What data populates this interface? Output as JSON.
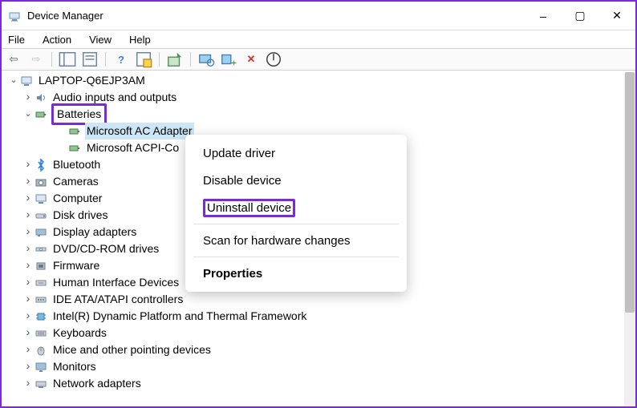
{
  "window": {
    "title": "Device Manager"
  },
  "menu": {
    "file": "File",
    "action": "Action",
    "view": "View",
    "help": "Help"
  },
  "root": "LAPTOP-Q6EJP3AM",
  "batteries": {
    "label": "Batteries",
    "children": {
      "ac": "Microsoft AC Adapter",
      "acpi": "Microsoft ACPI-Co"
    }
  },
  "cats": {
    "audio": "Audio inputs and outputs",
    "bluetooth": "Bluetooth",
    "cameras": "Cameras",
    "computer": "Computer",
    "disk": "Disk drives",
    "display": "Display adapters",
    "dvd": "DVD/CD-ROM drives",
    "firmware": "Firmware",
    "hid": "Human Interface Devices",
    "ide": "IDE ATA/ATAPI controllers",
    "intel": "Intel(R) Dynamic Platform and Thermal Framework",
    "keyboards": "Keyboards",
    "mice": "Mice and other pointing devices",
    "monitors": "Monitors",
    "network": "Network adapters"
  },
  "context": {
    "update": "Update driver",
    "disable": "Disable device",
    "uninstall": "Uninstall device",
    "scan": "Scan for hardware changes",
    "properties": "Properties"
  }
}
